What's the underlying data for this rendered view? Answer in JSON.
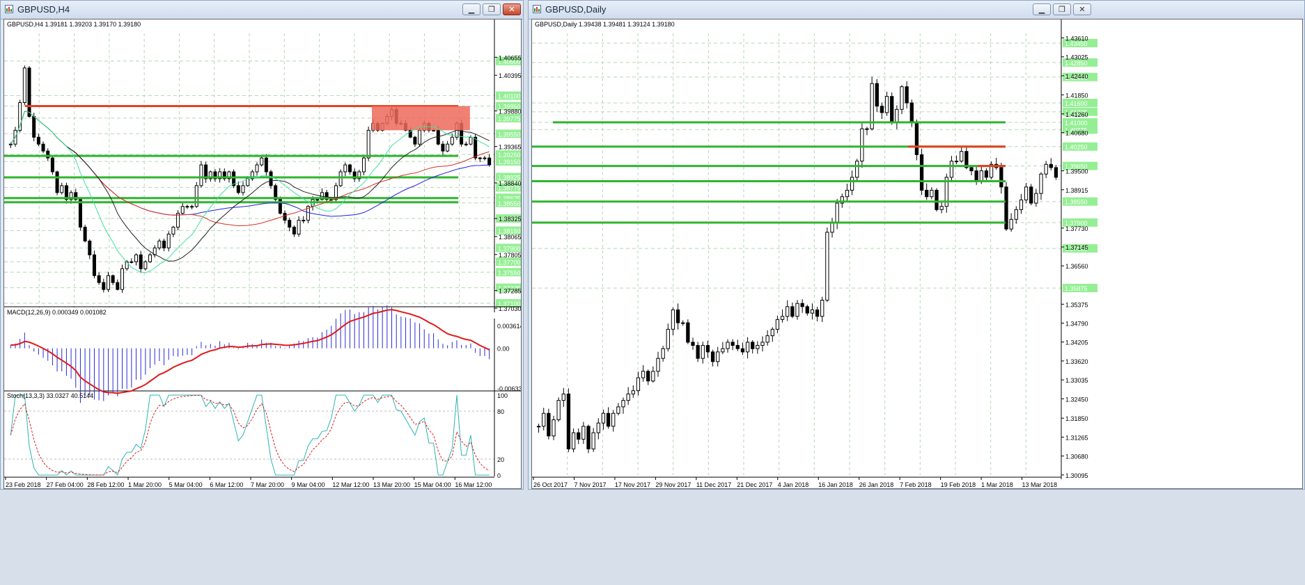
{
  "colors": {
    "candle_bull": "#ffffff",
    "candle_bear": "#000000",
    "grid": "#b5d6b5",
    "level_line": "#2db52d",
    "resistance_line": "#e8401f",
    "zone_fill": "#ec6a5a",
    "ma_blue": "#2020d8",
    "ma_red": "#d83020",
    "ma_black": "#222222",
    "ma_cyan": "#40e0a0",
    "macd_hist": "#2a2ad6",
    "macd_signal": "#e01818",
    "stoch_main": "#2bb5b5",
    "stoch_signal": "#d82020",
    "price_tag": "#94ef94"
  },
  "left_window": {
    "title": "GBPUSD,H4",
    "buttons": [
      "minimize",
      "restore",
      "close"
    ],
    "chart_header": "GBPUSD,H4  1.39181 1.39203 1.39170 1.39180",
    "macd_header": "MACD(12,26,9) 0.000349 0.001082",
    "stoch_header": "Stoch(13,3,3) 33.0327 40.5144"
  },
  "right_window": {
    "title": "GBPUSD,Daily",
    "buttons": [
      "minimize",
      "restore",
      "close"
    ],
    "chart_header": "GBPUSD,Daily  1.39438 1.39481 1.39124 1.39180"
  },
  "chart_data": [
    {
      "type": "candlestick",
      "symbol": "GBPUSD",
      "timeframe": "H4",
      "title": "GBPUSD,H4",
      "ylim": [
        1.3703,
        1.41
      ],
      "grid": true,
      "y_ticks": [
        "1.40655",
        "1.40395",
        "1.39880",
        "1.39365",
        "1.38840",
        "1.38325",
        "1.38065",
        "1.37805",
        "1.37285",
        "1.37030"
      ],
      "price_tags": [
        "1.40600",
        "1.40100",
        "1.39950",
        "1.39775",
        "1.39550",
        "1.39250",
        "1.39150",
        "1.38925",
        "1.38775",
        "1.38625",
        "1.38550",
        "1.38325",
        "1.38150",
        "1.37900",
        "1.37700",
        "1.37550",
        "1.37325",
        "1.37100"
      ],
      "x_labels": [
        "23 Feb 2018",
        "27 Feb 04:00",
        "28 Feb 12:00",
        "1 Mar 20:00",
        "5 Mar 04:00",
        "6 Mar 12:00",
        "7 Mar 20:00",
        "9 Mar 04:00",
        "12 Mar 12:00",
        "13 Mar 20:00",
        "15 Mar 04:00",
        "16 Mar 12:00"
      ],
      "horizontal_levels": [
        1.3995,
        1.3923,
        1.3892,
        1.3862,
        1.3856
      ],
      "resistance_zone": [
        1.3995,
        1.396
      ],
      "close": [
        1.394,
        1.396,
        1.4,
        1.405,
        1.398,
        1.395,
        1.394,
        1.393,
        1.392,
        1.39,
        1.387,
        1.388,
        1.386,
        1.387,
        1.386,
        1.382,
        1.38,
        1.378,
        1.375,
        1.374,
        1.373,
        1.375,
        1.374,
        1.373,
        1.376,
        1.377,
        1.377,
        1.378,
        1.376,
        1.377,
        1.378,
        1.379,
        1.38,
        1.379,
        1.381,
        1.382,
        1.384,
        1.385,
        1.385,
        1.385,
        1.388,
        1.391,
        1.389,
        1.39,
        1.389,
        1.39,
        1.389,
        1.39,
        1.388,
        1.387,
        1.388,
        1.389,
        1.39,
        1.391,
        1.392,
        1.39,
        1.388,
        1.386,
        1.384,
        1.383,
        1.382,
        1.381,
        1.383,
        1.383,
        1.385,
        1.386,
        1.386,
        1.387,
        1.386,
        1.386,
        1.388,
        1.39,
        1.391,
        1.39,
        1.389,
        1.39,
        1.392,
        1.396,
        1.397,
        1.396,
        1.397,
        1.398,
        1.399,
        1.397,
        1.397,
        1.396,
        1.395,
        1.394,
        1.396,
        1.397,
        1.396,
        1.396,
        1.394,
        1.393,
        1.394,
        1.395,
        1.397,
        1.394,
        1.394,
        1.395,
        1.392,
        1.392,
        1.392,
        1.391
      ],
      "macd": {
        "ylim": [
          -0.006335,
          0.003614
        ],
        "y_ticks": [
          "0.003614",
          "0.00",
          "-0.006335"
        ],
        "value": 0.000349,
        "signal": 0.001082
      },
      "stochastic": {
        "ylim": [
          0,
          100
        ],
        "levels": [
          20,
          80
        ],
        "y_ticks": [
          "100",
          "80",
          "20",
          "0"
        ],
        "main": 33.0327,
        "signal": 40.5144
      }
    },
    {
      "type": "candlestick",
      "symbol": "GBPUSD",
      "timeframe": "Daily",
      "title": "GBPUSD,Daily",
      "ylim": [
        1.3009,
        1.4375
      ],
      "grid": true,
      "y_ticks": [
        "1.43610",
        "1.43025",
        "1.42440",
        "1.41850",
        "1.41260",
        "1.40680",
        "1.39500",
        "1.38915",
        "1.37730",
        "1.37145",
        "1.36560",
        "1.35375",
        "1.34790",
        "1.34205",
        "1.33620",
        "1.33035",
        "1.32450",
        "1.31850",
        "1.31265",
        "1.30680",
        "1.30095"
      ],
      "price_tags": [
        "1.43450",
        "1.42850",
        "1.42400",
        "1.41600",
        "1.41325",
        "1.41000",
        "1.40775",
        "1.40250",
        "1.39650",
        "1.38550",
        "1.37900",
        "1.37100",
        "1.35875"
      ],
      "x_labels": [
        "26 Oct 2017",
        "7 Nov 2017",
        "17 Nov 2017",
        "29 Nov 2017",
        "11 Dec 2017",
        "21 Dec 2017",
        "4 Jan 2018",
        "16 Jan 2018",
        "26 Jan 2018",
        "7 Feb 2018",
        "19 Feb 2018",
        "1 Mar 2018",
        "13 Mar 2018"
      ],
      "horizontal_levels": [
        1.41,
        1.4025,
        1.3965,
        1.3918,
        1.3855,
        1.379
      ],
      "close": [
        1.316,
        1.32,
        1.313,
        1.318,
        1.324,
        1.326,
        1.309,
        1.314,
        1.312,
        1.316,
        1.309,
        1.314,
        1.317,
        1.32,
        1.316,
        1.32,
        1.322,
        1.324,
        1.326,
        1.327,
        1.331,
        1.333,
        1.33,
        1.333,
        1.337,
        1.34,
        1.346,
        1.352,
        1.348,
        1.348,
        1.342,
        1.341,
        1.337,
        1.341,
        1.339,
        1.336,
        1.339,
        1.34,
        1.342,
        1.341,
        1.34,
        1.339,
        1.342,
        1.34,
        1.341,
        1.342,
        1.344,
        1.346,
        1.349,
        1.35,
        1.353,
        1.35,
        1.354,
        1.353,
        1.351,
        1.352,
        1.35,
        1.355,
        1.376,
        1.379,
        1.385,
        1.387,
        1.389,
        1.393,
        1.398,
        1.408,
        1.408,
        1.422,
        1.415,
        1.413,
        1.418,
        1.41,
        1.414,
        1.421,
        1.416,
        1.41,
        1.4,
        1.389,
        1.387,
        1.389,
        1.383,
        1.384,
        1.393,
        1.398,
        1.398,
        1.401,
        1.396,
        1.395,
        1.392,
        1.395,
        1.393,
        1.397,
        1.396,
        1.39,
        1.377,
        1.38,
        1.383,
        1.386,
        1.39,
        1.385,
        1.388,
        1.394,
        1.397,
        1.396,
        1.393
      ]
    }
  ]
}
